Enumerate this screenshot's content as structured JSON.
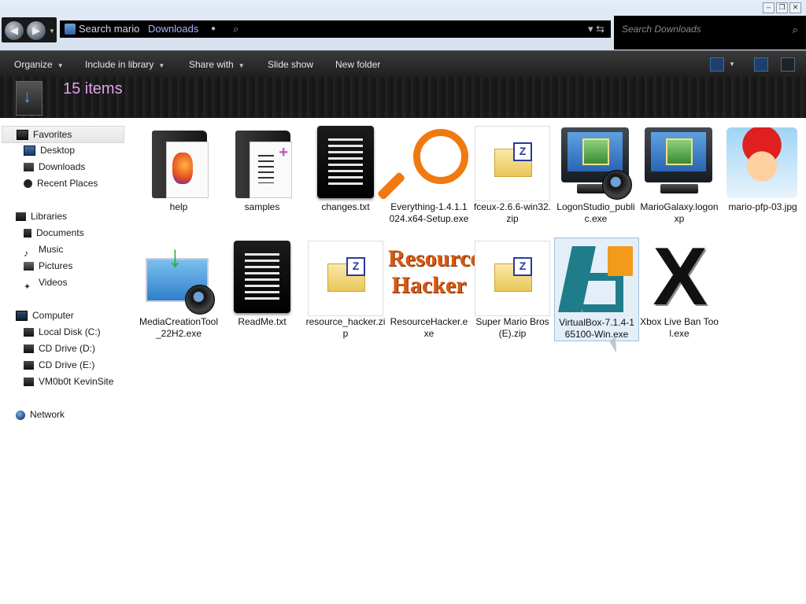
{
  "window": {
    "address": {
      "path_prefix": "Search mario",
      "crumb": "Downloads",
      "separator_icon": "dropdown-dot-icon",
      "search_icon": "search-icon"
    },
    "search": {
      "placeholder": "Search Downloads"
    }
  },
  "toolbar": {
    "organize": "Organize",
    "include_in_library": "Include in library",
    "share_with": "Share with",
    "slide_show": "Slide show",
    "new_folder": "New folder"
  },
  "header": {
    "item_count": "15 items"
  },
  "sidebar": {
    "favorites": "Favorites",
    "desktop": "Desktop",
    "downloads": "Downloads",
    "recent_places": "Recent Places",
    "libraries": "Libraries",
    "documents": "Documents",
    "music": "Music",
    "pictures": "Pictures",
    "videos": "Videos",
    "computer": "Computer",
    "local_disk": "Local Disk (C:)",
    "cd_drive_d": "CD Drive (D:)",
    "cd_drive_e": "CD Drive (E:)",
    "vm_drive": "VM0b0t KevinSite",
    "network": "Network"
  },
  "files": [
    {
      "name": "help",
      "icon": "firefox-folder-icon"
    },
    {
      "name": "samples",
      "icon": "document-folder-icon"
    },
    {
      "name": "changes.txt",
      "icon": "text-file-icon"
    },
    {
      "name": "Everything-1.4.1.1024.x64-Setup.exe",
      "icon": "magnifier-icon"
    },
    {
      "name": "fceux-2.6.6-win32.zip",
      "icon": "zip-icon"
    },
    {
      "name": "LogonStudio_public.exe",
      "icon": "monitor-user-icon"
    },
    {
      "name": "MarioGalaxy.logonxp",
      "icon": "monitor-user-icon"
    },
    {
      "name": "mario-pfp-03.jpg",
      "icon": "mario-image-icon"
    },
    {
      "name": "MediaCreationTool_22H2.exe",
      "icon": "media-creation-icon"
    },
    {
      "name": "ReadMe.txt",
      "icon": "text-file-icon"
    },
    {
      "name": "resource_hacker.zip",
      "icon": "zip-icon"
    },
    {
      "name": "ResourceHacker.exe",
      "icon": "resource-hacker-icon",
      "logo_text": "Resource Hacker"
    },
    {
      "name": "Super Mario Bros (E).zip",
      "icon": "zip-icon"
    },
    {
      "name": "VirtualBox-7.1.4-165100-Win.exe",
      "icon": "virtualbox-icon",
      "selected": true
    },
    {
      "name": "Xbox Live Ban Tool.exe",
      "icon": "x-logo-icon"
    }
  ]
}
